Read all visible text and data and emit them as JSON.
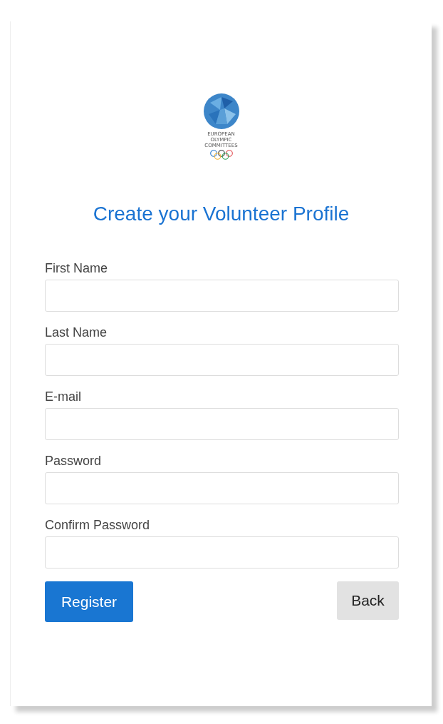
{
  "logo": {
    "lines": [
      "EUROPEAN",
      "OLYMPIC",
      "COMMITTEES"
    ]
  },
  "title": "Create your Volunteer Profile",
  "fields": [
    {
      "label": "First Name"
    },
    {
      "label": "Last Name"
    },
    {
      "label": "E-mail"
    },
    {
      "label": "Password"
    },
    {
      "label": "Confirm Password"
    }
  ],
  "buttons": {
    "primary": "Register",
    "secondary": "Back"
  }
}
